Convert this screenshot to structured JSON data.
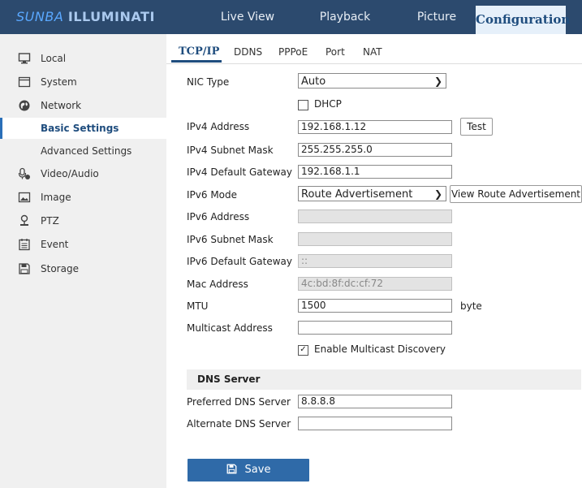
{
  "brand": {
    "part1": "SUNBA",
    "part2": "ILLUMINATI"
  },
  "nav": [
    {
      "label": "Live View"
    },
    {
      "label": "Playback"
    },
    {
      "label": "Picture"
    },
    {
      "label": "Configuration"
    }
  ],
  "sidebar": {
    "items": [
      {
        "label": "Local",
        "icon": "monitor-icon"
      },
      {
        "label": "System",
        "icon": "window-icon"
      },
      {
        "label": "Network",
        "icon": "globe-icon"
      },
      {
        "label": "Basic Settings"
      },
      {
        "label": "Advanced Settings"
      },
      {
        "label": "Video/Audio",
        "icon": "mic-icon"
      },
      {
        "label": "Image",
        "icon": "image-icon"
      },
      {
        "label": "PTZ",
        "icon": "ptz-icon"
      },
      {
        "label": "Event",
        "icon": "calendar-icon"
      },
      {
        "label": "Storage",
        "icon": "save-icon"
      }
    ]
  },
  "tabs": [
    "TCP/IP",
    "DDNS",
    "PPPoE",
    "Port",
    "NAT"
  ],
  "form": {
    "nic_type": {
      "label": "NIC Type",
      "value": "Auto"
    },
    "dhcp": {
      "label": "DHCP",
      "checked": false
    },
    "ipv4_address": {
      "label": "IPv4 Address",
      "value": "192.168.1.12"
    },
    "test_label": "Test",
    "ipv4_mask": {
      "label": "IPv4 Subnet Mask",
      "value": "255.255.255.0"
    },
    "ipv4_gateway": {
      "label": "IPv4 Default Gateway",
      "value": "192.168.1.1"
    },
    "ipv6_mode": {
      "label": "IPv6 Mode",
      "value": "Route Advertisement"
    },
    "view_route_label": "View Route Advertisement",
    "ipv6_address": {
      "label": "IPv6 Address",
      "value": ""
    },
    "ipv6_mask": {
      "label": "IPv6 Subnet Mask",
      "value": ""
    },
    "ipv6_gateway": {
      "label": "IPv6 Default Gateway",
      "value": "::"
    },
    "mac": {
      "label": "Mac Address",
      "value": "4c:bd:8f:dc:cf:72"
    },
    "mtu": {
      "label": "MTU",
      "value": "1500",
      "unit": "byte"
    },
    "multicast": {
      "label": "Multicast Address",
      "value": ""
    },
    "multicast_discovery": {
      "label": "Enable Multicast Discovery",
      "checked": true
    }
  },
  "dns": {
    "title": "DNS Server",
    "preferred": {
      "label": "Preferred DNS Server",
      "value": "8.8.8.8"
    },
    "alternate": {
      "label": "Alternate DNS Server",
      "value": ""
    }
  },
  "save_label": "Save",
  "colors": {
    "topbar": "#2c4a6e",
    "accent": "#2f6aa8",
    "active_tab": "#1f4d7e"
  }
}
